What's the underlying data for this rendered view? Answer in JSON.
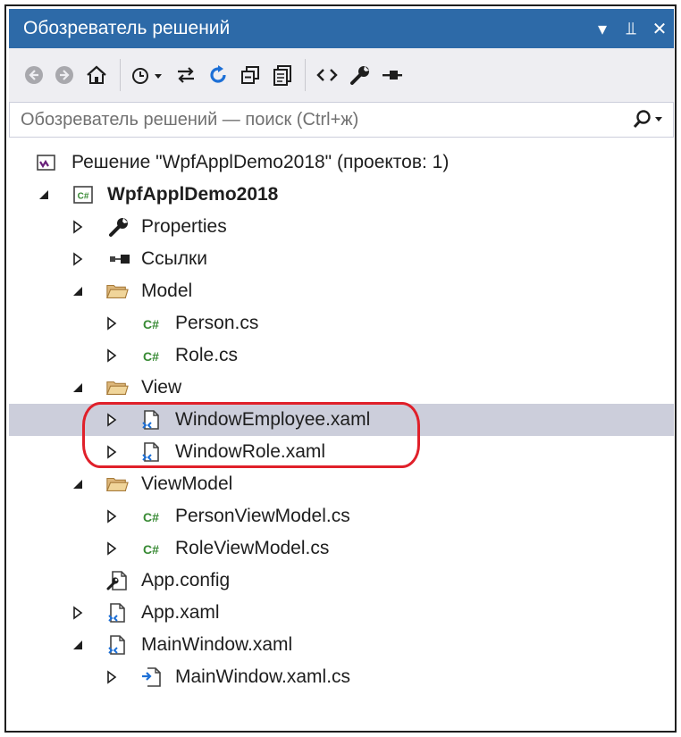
{
  "window": {
    "title": "Обозреватель решений",
    "controls": [
      "▾",
      "⫫",
      "✕"
    ]
  },
  "search": {
    "placeholder": "Обозреватель решений — поиск (Ctrl+ж)"
  },
  "tree": {
    "solution": "Решение \"WpfApplDemo2018\"  (проектов: 1)",
    "project": "WpfApplDemo2018",
    "properties": "Properties",
    "references": "Ссылки",
    "model_folder": "Model",
    "person_cs": "Person.cs",
    "role_cs": "Role.cs",
    "view_folder": "View",
    "window_employee": "WindowEmployee.xaml",
    "window_role": "WindowRole.xaml",
    "viewmodel_folder": "ViewModel",
    "person_vm": "PersonViewModel.cs",
    "role_vm": "RoleViewModel.cs",
    "app_config": "App.config",
    "app_xaml": "App.xaml",
    "main_window": "MainWindow.xaml",
    "main_window_cs": "MainWindow.xaml.cs"
  },
  "colors": {
    "title_bg": "#2d6aa8",
    "selection": "#cccedb",
    "annotation": "#e0202a",
    "csharp_green": "#388a34"
  }
}
